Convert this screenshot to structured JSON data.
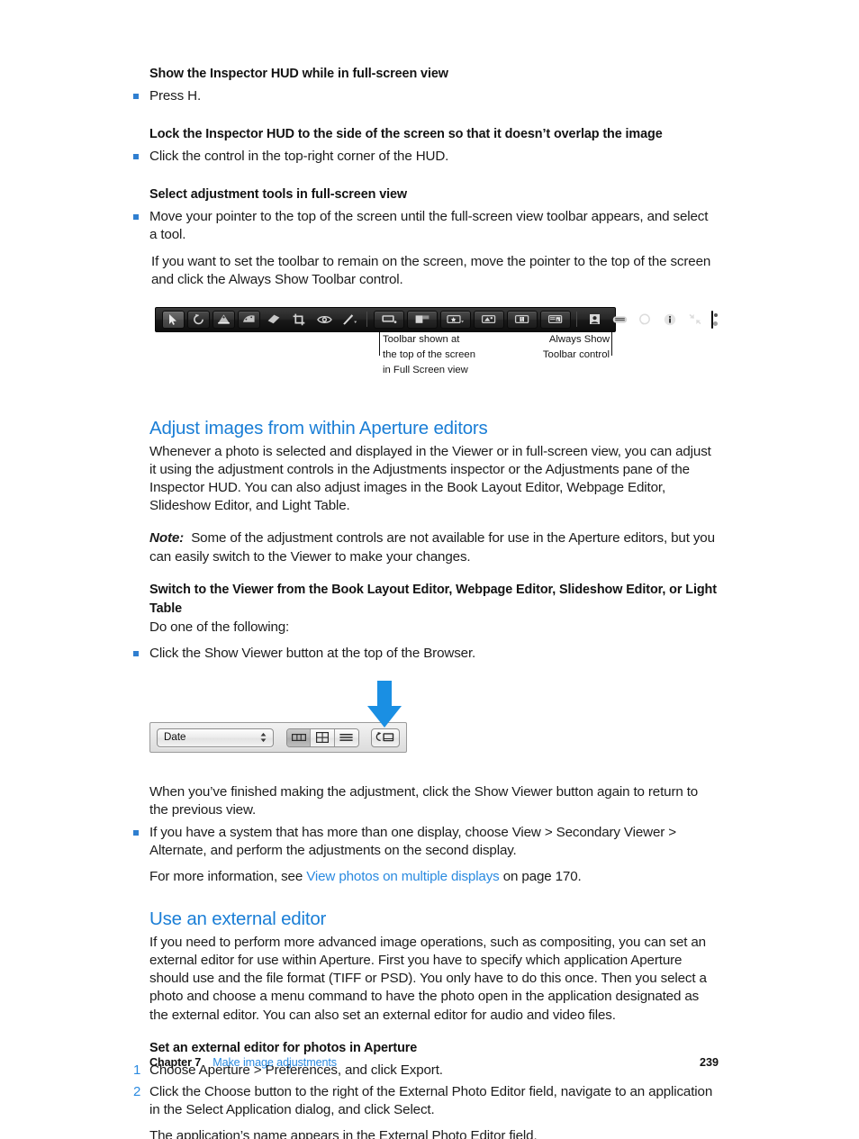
{
  "document": {
    "sections": [
      {
        "id": "show-inspector-hud",
        "task_heading": "Show the Inspector HUD while in full-screen view",
        "steps": [
          "Press H."
        ]
      },
      {
        "id": "lock-inspector-hud",
        "task_heading": "Lock the Inspector HUD to the side of the screen so that it doesn’t overlap the image",
        "steps": [
          "Click the control in the top-right corner of the HUD."
        ]
      },
      {
        "id": "select-adjustment-tools",
        "task_heading": "Select adjustment tools in full-screen view",
        "steps": [
          "Move your pointer to the top of the screen until the full-screen view toolbar appears, and select a tool."
        ],
        "note": "If you want to set the toolbar to remain on the screen, move the pointer to the top of the screen and click the Always Show Toolbar control."
      }
    ]
  },
  "figure_toolbar": {
    "callout_left": "Toolbar shown at\nthe top of the screen\nin Full Screen view",
    "callout_right": "Always Show\nToolbar control",
    "icons": [
      "selection-arrow-icon",
      "rotate-left-icon",
      "straighten-icon",
      "flip-icon",
      "lift-stamp-icon",
      "crop-icon",
      "red-eye-icon",
      "retouch-brush-icon",
      "quick-brush-icon",
      "effects-icon",
      "rating-icon",
      "keyword-icon",
      "keyword-preset-icon",
      "metadata-icon",
      "loupe-panel-icon",
      "inspector-icon",
      "browser-icon",
      "loupe-icon",
      "info-icon",
      "exit-fullscreen-icon",
      "always-show-toolbar-control"
    ]
  },
  "section_adjust_editors": {
    "heading": "Adjust images from within Aperture editors",
    "paragraph": "Whenever a photo is selected and displayed in the Viewer or in full-screen view, you can adjust it using the adjustment controls in the Adjustments inspector or the Adjustments pane of the Inspector HUD. You can also adjust images in the Book Layout Editor, Webpage Editor, Slideshow Editor, and Light Table.",
    "note_label": "Note:",
    "note_text": "Some of the adjustment controls are not available for use in the Aperture editors, but you can easily switch to the Viewer to make your changes.",
    "task_heading": "Switch to the Viewer from the Book Layout Editor, Webpage Editor, Slideshow Editor, or Light Table",
    "lead_in": "Do one of the following:",
    "step_1": "Click the Show Viewer button at the top of the Browser.",
    "after_figure": "When you’ve finished making the adjustment, click the Show Viewer button again to return to the previous view.",
    "step_2": "If you have a system that has more than one display, choose View > Secondary Viewer > Alternate, and perform the adjustments on the second display.",
    "more_info_prefix": "For more information, see ",
    "more_info_link": "View photos on multiple displays",
    "more_info_suffix": " on page 170."
  },
  "figure_browser": {
    "popup_value": "Date",
    "popup_name": "sort-by-popup",
    "view_buttons": [
      "filmstrip-view-icon",
      "grid-view-icon",
      "list-view-icon"
    ],
    "active_view": "filmstrip-view-icon",
    "show_viewer_button": "show-viewer-icon",
    "arrow": "blue-down-arrow"
  },
  "section_external_editor": {
    "heading": "Use an external editor",
    "paragraph": "If you need to perform more advanced image operations, such as compositing, you can set an external editor for use within Aperture. First you have to specify which application Aperture should use and the file format (TIFF or PSD). You only have to do this once. Then you select a photo and choose a menu command to have the photo open in the application designated as the external editor. You can also set an external editor for audio and video files.",
    "task_heading": "Set an external editor for photos in Aperture",
    "steps": [
      {
        "number": "1",
        "text": "Choose Aperture > Preferences, and click Export."
      },
      {
        "number": "2",
        "text": "Click the Choose button to the right of the External Photo Editor field, navigate to an application in the Select Application dialog, and click Select."
      }
    ],
    "result": "The application’s name appears in the External Photo Editor field."
  },
  "footer": {
    "chapter": "Chapter 7",
    "title": "Make image adjustments",
    "page": "239"
  },
  "colors": {
    "link": "#2a8ae0",
    "heading": "#1a7ed6",
    "bullet": "#2f7fd0",
    "arrow": "#1a8fe3"
  }
}
